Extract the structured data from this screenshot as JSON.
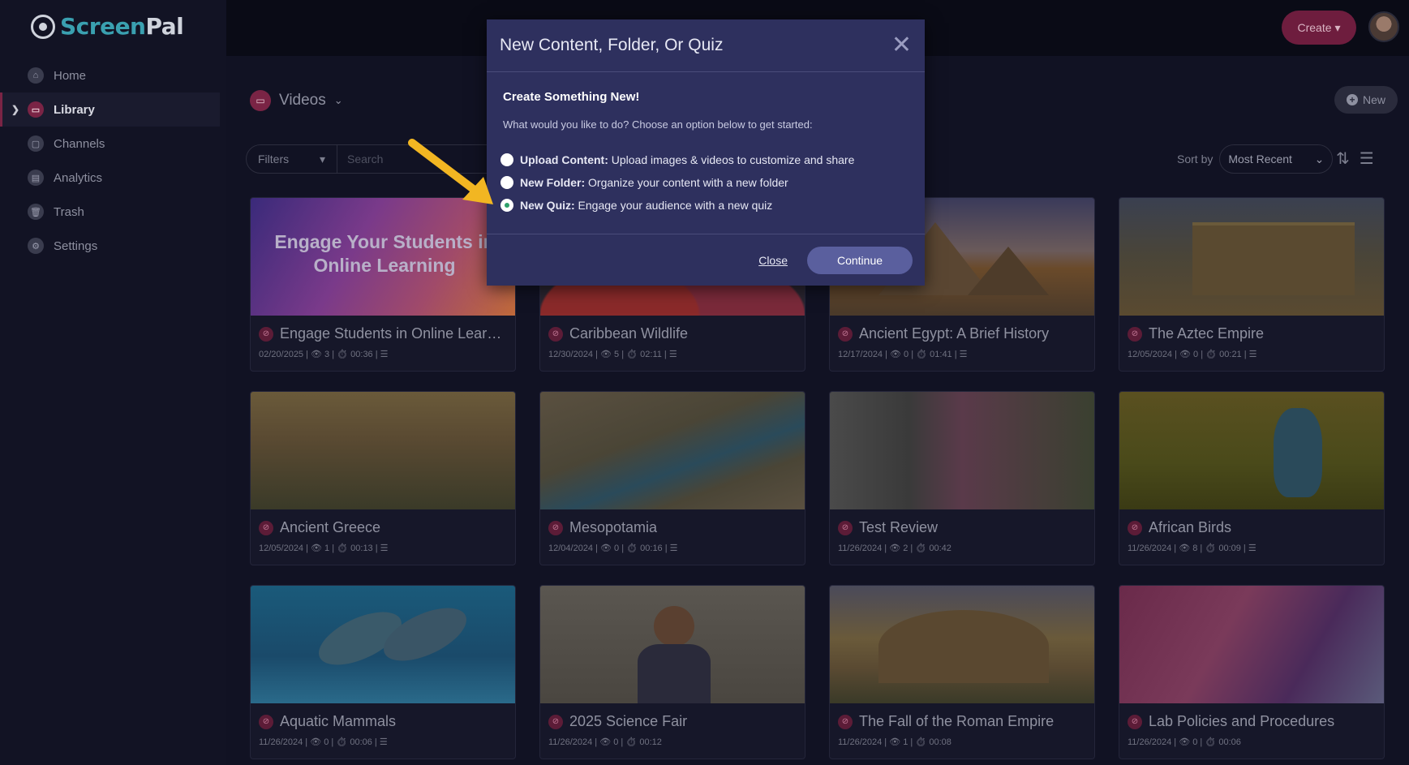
{
  "app": {
    "logo_screen": "Screen",
    "logo_pal": "Pal"
  },
  "sidebar": {
    "items": [
      {
        "label": "Home",
        "icon": "home-icon"
      },
      {
        "label": "Library",
        "icon": "library-icon",
        "active": true
      },
      {
        "label": "Channels",
        "icon": "channels-icon"
      },
      {
        "label": "Analytics",
        "icon": "analytics-icon"
      },
      {
        "label": "Trash",
        "icon": "trash-icon"
      },
      {
        "label": "Settings",
        "icon": "settings-icon"
      }
    ]
  },
  "header": {
    "create_label": "Create"
  },
  "library": {
    "title": "Videos",
    "new_label": "New",
    "filters_label": "Filters",
    "search_placeholder": "Search",
    "sort_label": "Sort by",
    "sort_value": "Most Recent"
  },
  "cards": [
    {
      "title": "Engage Students in Online Learn...",
      "meta": "02/20/2025 | 👁 3 | ⏱ 00:36 | ☰",
      "thumb_text": "Engage Your Students in Online Learning"
    },
    {
      "title": "Caribbean Wildlife",
      "meta": "12/30/2024 | 👁 5 | ⏱ 02:11 | ☰"
    },
    {
      "title": "Ancient Egypt: A Brief History",
      "meta": "12/17/2024 | 👁 0 | ⏱ 01:41 | ☰"
    },
    {
      "title": "The Aztec Empire",
      "meta": "12/05/2024 | 👁 0 | ⏱ 00:21 | ☰"
    },
    {
      "title": "Ancient Greece",
      "meta": "12/05/2024 | 👁 1 | ⏱ 00:13 | ☰"
    },
    {
      "title": "Mesopotamia",
      "meta": "12/04/2024 | 👁 0 | ⏱ 00:16 | ☰"
    },
    {
      "title": "Test Review",
      "meta": "11/26/2024 | 👁 2 | ⏱ 00:42"
    },
    {
      "title": "African Birds",
      "meta": "11/26/2024 | 👁 8 | ⏱ 00:09 | ☰"
    },
    {
      "title": "Aquatic Mammals",
      "meta": "11/26/2024 | 👁 0 | ⏱ 00:06 | ☰"
    },
    {
      "title": "2025 Science Fair",
      "meta": "11/26/2024 | 👁 0 | ⏱ 00:12"
    },
    {
      "title": "The Fall of the Roman Empire",
      "meta": "11/26/2024 | 👁 1 | ⏱ 00:08"
    },
    {
      "title": "Lab Policies and Procedures",
      "meta": "11/26/2024 | 👁 0 | ⏱ 00:06"
    }
  ],
  "modal": {
    "title": "New Content, Folder, Or Quiz",
    "heading": "Create Something New!",
    "description": "What would you like to do? Choose an option below to get started:",
    "options": [
      {
        "bold": "Upload Content:",
        "text": " Upload images & videos to customize and share",
        "selected": false
      },
      {
        "bold": "New Folder:",
        "text": " Organize your content with a new folder",
        "selected": false
      },
      {
        "bold": "New Quiz:",
        "text": " Engage your audience with a new quiz",
        "selected": true
      }
    ],
    "close_label": "Close",
    "continue_label": "Continue"
  },
  "colors": {
    "accent": "#7a2445",
    "modal_bg": "#2e305e",
    "selected_radio": "#2ea06a",
    "arrow": "#f2b622"
  }
}
